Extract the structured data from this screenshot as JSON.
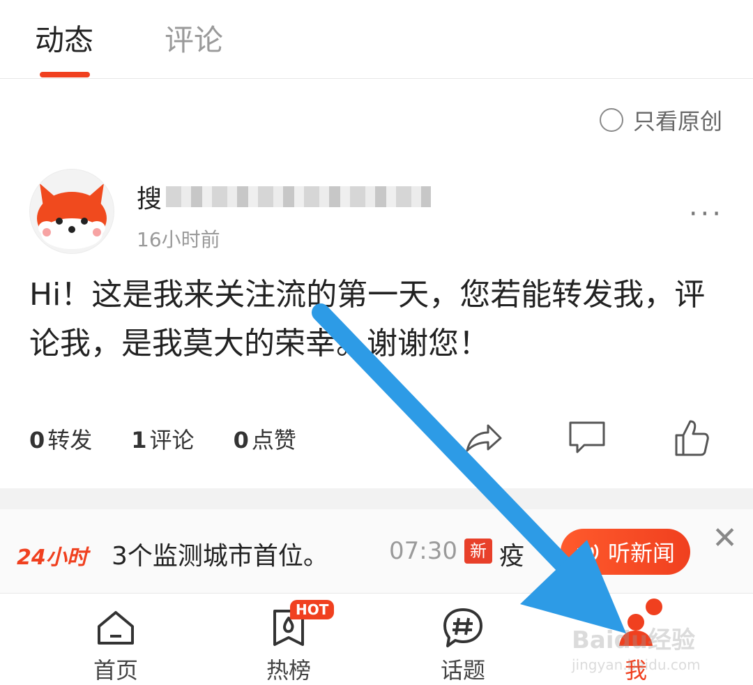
{
  "tabs": [
    {
      "label": "动态",
      "active": true
    },
    {
      "label": "评论",
      "active": false
    }
  ],
  "filter": {
    "label": "只看原创",
    "checked": false
  },
  "post": {
    "username_visible": "搜",
    "time": "16小时前",
    "text": "Hi！这是我来关注流的第一天，您若能转发我，评论我，是我莫大的荣幸。谢谢您！",
    "stats": {
      "reposts": "0",
      "reposts_label": "转发",
      "comments": "1",
      "comments_label": "评论",
      "likes": "0",
      "likes_label": "点赞"
    }
  },
  "news_bar": {
    "logo": "24小时",
    "headline": "3个监测城市首位。",
    "time": "07:30",
    "badge": "新",
    "trail": "疫",
    "listen_label": "听新闻"
  },
  "bottom_nav": [
    {
      "label": "首页",
      "icon": "home-icon"
    },
    {
      "label": "热榜",
      "icon": "hot-list-icon",
      "badge": "HOT"
    },
    {
      "label": "话题",
      "icon": "topic-icon"
    },
    {
      "label": "我",
      "icon": "me-icon",
      "active": true
    }
  ],
  "watermark": {
    "text": "Baidu经验",
    "sub": "jingyan.baidu.com"
  },
  "colors": {
    "accent": "#f0401f",
    "arrow": "#2d9be6"
  }
}
